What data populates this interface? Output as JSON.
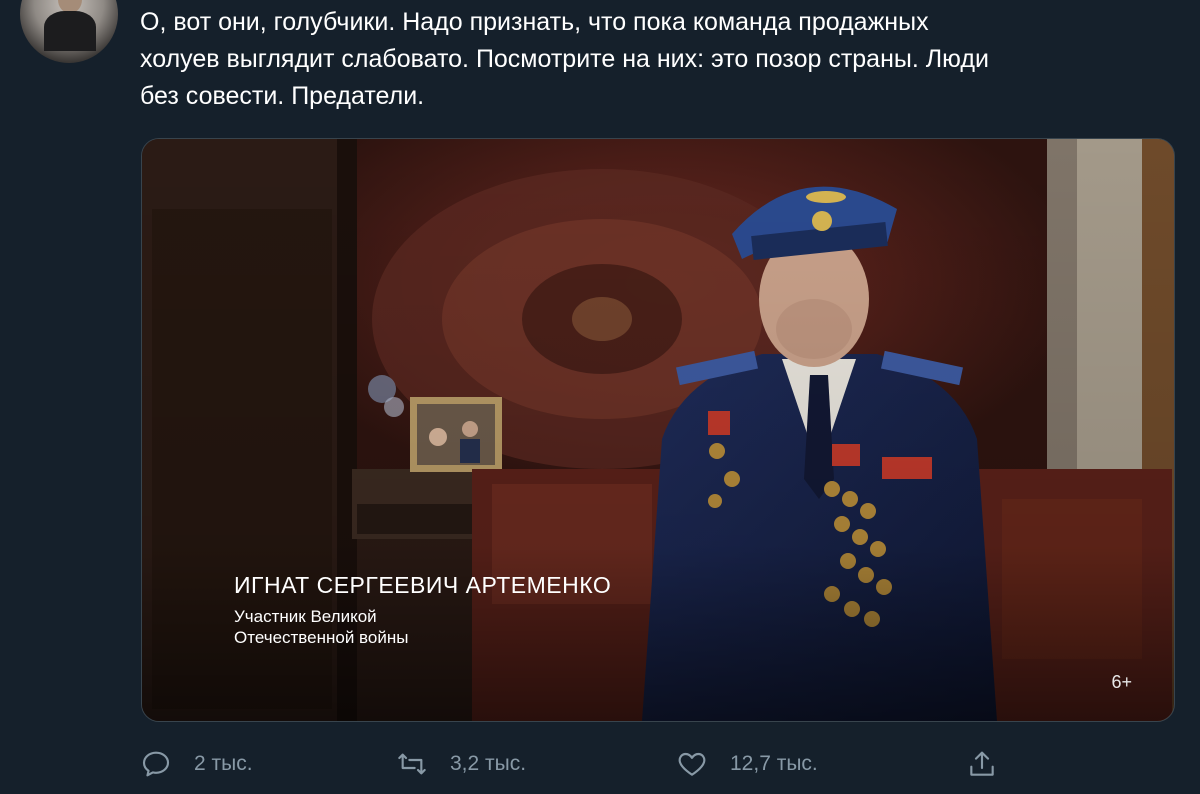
{
  "tweet": {
    "avatar": "avatar",
    "text": "О, вот они, голубчики. Надо признать, что пока команда продажных\nхолуев выглядит слабовато. Посмотрите на них: это позор страны. Люди\nбез совести. Предатели."
  },
  "media": {
    "caption_name": "ИГНАТ СЕРГЕЕВИЧ АРТЕМЕНКО",
    "caption_line1": "Участник Великой",
    "caption_line2": "Отечественной войны",
    "age_rating": "6+"
  },
  "actions": {
    "reply": {
      "icon": "reply-icon",
      "count": "2 тыс."
    },
    "retweet": {
      "icon": "retweet-icon",
      "count": "3,2 тыс."
    },
    "like": {
      "icon": "heart-icon",
      "count": "12,7 тыс."
    },
    "share": {
      "icon": "share-icon"
    }
  },
  "colors": {
    "background": "#15202b",
    "icon": "#8899a6",
    "border": "#38444d"
  }
}
